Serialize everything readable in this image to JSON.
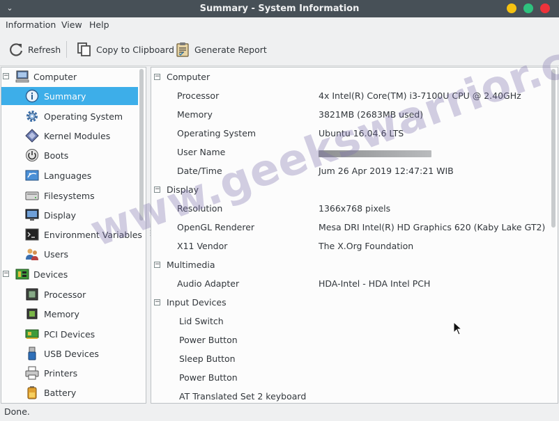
{
  "window": {
    "title": "Summary - System Information"
  },
  "menubar": {
    "items": [
      "Information",
      "View",
      "Help"
    ]
  },
  "toolbar": {
    "refresh_label": "Refresh",
    "copy_label": "Copy to Clipboard",
    "report_label": "Generate Report"
  },
  "sidebar": {
    "groups": [
      {
        "label": "Computer",
        "expander": "−",
        "items": [
          {
            "label": "Summary",
            "selected": true
          },
          {
            "label": "Operating System"
          },
          {
            "label": "Kernel Modules"
          },
          {
            "label": "Boots"
          },
          {
            "label": "Languages"
          },
          {
            "label": "Filesystems"
          },
          {
            "label": "Display"
          },
          {
            "label": "Environment Variables"
          },
          {
            "label": "Users"
          }
        ]
      },
      {
        "label": "Devices",
        "expander": "−",
        "items": [
          {
            "label": "Processor"
          },
          {
            "label": "Memory"
          },
          {
            "label": "PCI Devices"
          },
          {
            "label": "USB Devices"
          },
          {
            "label": "Printers"
          },
          {
            "label": "Battery"
          }
        ]
      }
    ]
  },
  "content": {
    "sections": [
      {
        "title": "Computer",
        "expander": "−",
        "rows": [
          {
            "key": "Processor",
            "value": "4x Intel(R) Core(TM) i3-7100U CPU @ 2.40GHz"
          },
          {
            "key": "Memory",
            "value": "3821MB (2683MB used)"
          },
          {
            "key": "Operating System",
            "value": "Ubuntu 16.04.6 LTS"
          },
          {
            "key": "User Name",
            "value": ""
          },
          {
            "key": "Date/Time",
            "value": "Jum 26 Apr 2019 12:47:21  WIB"
          }
        ]
      },
      {
        "title": "Display",
        "expander": "−",
        "rows": [
          {
            "key": "Resolution",
            "value": "1366x768 pixels"
          },
          {
            "key": "OpenGL Renderer",
            "value": "Mesa DRI Intel(R) HD Graphics 620 (Kaby Lake GT2)"
          },
          {
            "key": "X11 Vendor",
            "value": "The X.Org Foundation"
          }
        ]
      },
      {
        "title": "Multimedia",
        "expander": "−",
        "rows": [
          {
            "key": "Audio Adapter",
            "value": "HDA-Intel - HDA Intel PCH"
          }
        ]
      },
      {
        "title": "Input Devices",
        "expander": "−",
        "rows": [
          {
            "key": "Lid Switch",
            "value": ""
          },
          {
            "key": "Power Button",
            "value": ""
          },
          {
            "key": "Sleep Button",
            "value": ""
          },
          {
            "key": "Power Button",
            "value": ""
          },
          {
            "key": "AT Translated Set 2 keyboard",
            "value": ""
          }
        ]
      }
    ]
  },
  "watermark": "www.geekswarrior.com",
  "status": {
    "text": "Done."
  },
  "colors": {
    "selection": "#3daee9",
    "titlebar": "#475057"
  }
}
